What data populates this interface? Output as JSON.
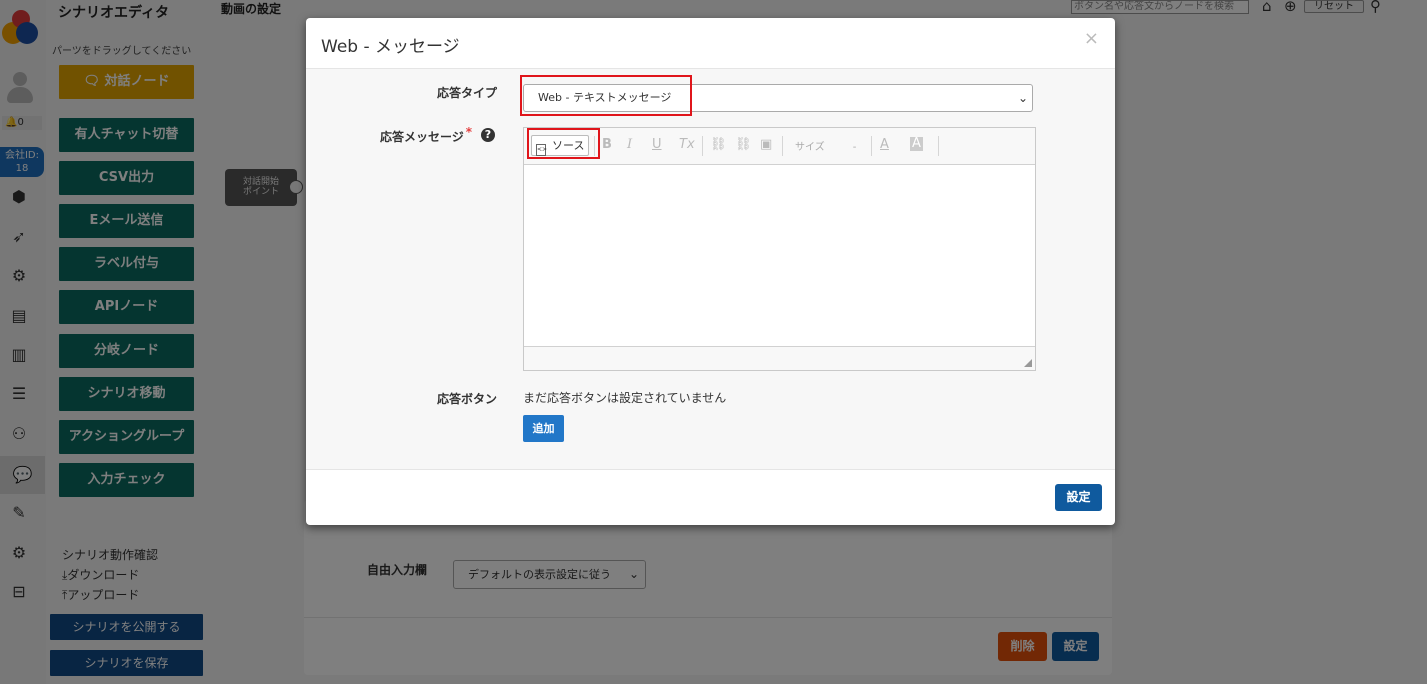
{
  "sidebar": {
    "title": "シナリオエディタ",
    "hint": "パーツをドラッグしてください",
    "notification_count": "0",
    "company_label": "会社ID:",
    "company_id": "18",
    "nodes": [
      {
        "label": "対話ノード"
      },
      {
        "label": "有人チャット切替"
      },
      {
        "label": "CSV出力"
      },
      {
        "label": "Eメール送信"
      },
      {
        "label": "ラベル付与"
      },
      {
        "label": "APIノード"
      },
      {
        "label": "分岐ノード"
      },
      {
        "label": "シナリオ移動"
      },
      {
        "label": "アクショングループ"
      },
      {
        "label": "入力チェック"
      }
    ],
    "scenario_check": "シナリオ動作確認",
    "download": "ダウンロード",
    "upload": "アップロード",
    "publish_button": "シナリオを公開する",
    "save_button": "シナリオを保存"
  },
  "canvas": {
    "header": "動画の設定",
    "start_point": [
      "対話開始",
      "ポイント"
    ],
    "search_placeholder": "ボタン名や応答文からノードを検索",
    "reset": "リセット"
  },
  "back_modal": {
    "free_input_label": "自由入力欄",
    "free_input_value": "デフォルトの表示設定に従う",
    "delete_button": "削除",
    "set_button": "設定"
  },
  "modal": {
    "title": "Web - メッセージ",
    "close": "×",
    "response_type_label": "応答タイプ",
    "response_type_value": "Web - テキストメッセージ",
    "response_message_label": "応答メッセージ",
    "required_mark": "*",
    "help": "?",
    "editor": {
      "source_button": "ソース",
      "bold": "B",
      "italic": "I",
      "underline": "U",
      "clear_format": "Tx",
      "size_label": "サイズ",
      "size_caret": "-",
      "text_color": "A",
      "bg_color": "A"
    },
    "response_button_label": "応答ボタン",
    "no_buttons_text": "まだ応答ボタンは設定されていません",
    "add_button": "追加",
    "set_button": "設定"
  }
}
